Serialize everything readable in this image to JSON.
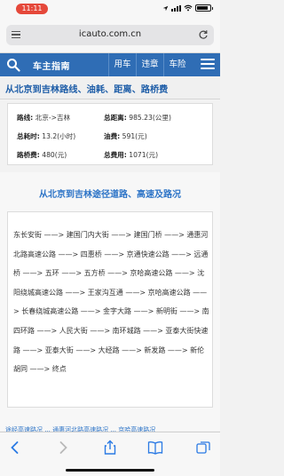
{
  "status_bar": {
    "time": "11:11"
  },
  "browser": {
    "url": "icauto.com.cn"
  },
  "site_nav": {
    "title": "车主指南",
    "links": [
      "用车",
      "违章",
      "车险"
    ]
  },
  "page": {
    "title": "从北京到吉林路线、油耗、距离、路桥费"
  },
  "summary": {
    "route_label": "路线:",
    "route_value": "北京->吉林",
    "distance_label": "总距离:",
    "distance_value": "985.23(公里)",
    "duration_label": "总耗时:",
    "duration_value": "13.2(小时)",
    "fuel_label": "油费:",
    "fuel_value": "591(元)",
    "toll_label": "路桥费:",
    "toll_value": "480(元)",
    "total_label": "总费用:",
    "total_value": "1071(元)"
  },
  "route_section": {
    "title": "从北京到吉林途径道路、高速及路况",
    "text": "东长安街 ——> 建国门内大街 ——> 建国门桥 ——> 通惠河北路高速公路 ——> 四惠桥 ——> 京通快速公路 ——> 远通桥 ——> 五环 ——> 五方桥 ——> 京哈高速公路 ——> 沈阳绕城高速公路 ——> 王家沟互通 ——> 京哈高速公路 ——> 长春绕城高速公路 ——> 金字大路 ——> 新明街 ——> 南四环路 ——> 人民大街 ——> 南环城路 ——> 亚泰大街快速路 ——> 亚泰大街 ——> 大经路 ——> 新发路 ——> 新伦胡同 ——> 终点"
  },
  "next_links": "途经高速路况 ... 通惠河北路高速路况 ... 京哈高速路况"
}
